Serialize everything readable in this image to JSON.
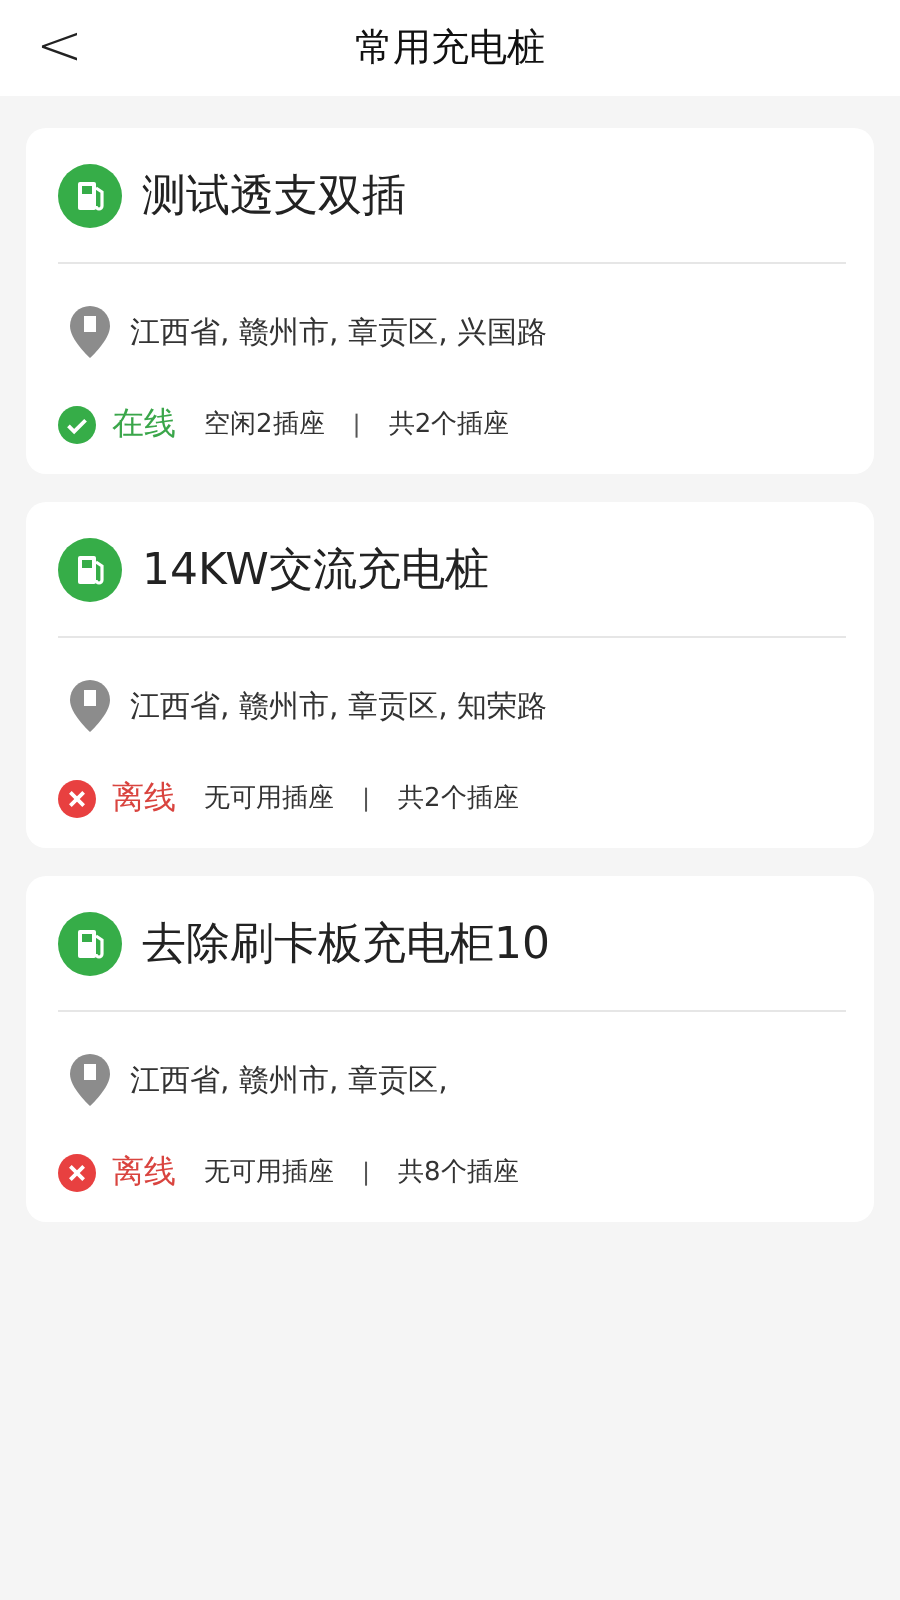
{
  "header": {
    "back": "<",
    "title": "常用充电桩"
  },
  "stations": [
    {
      "name": "测试透支双插",
      "address": "江西省, 赣州市, 章贡区, 兴国路",
      "online": true,
      "status": "在线",
      "free": "空闲2插座",
      "separator": "|",
      "total": "共2个插座"
    },
    {
      "name": "14KW交流充电桩",
      "address": "江西省, 赣州市, 章贡区, 知荣路",
      "online": false,
      "status": "离线",
      "free": "无可用插座",
      "separator": "|",
      "total": "共2个插座"
    },
    {
      "name": "去除刷卡板充电柜10",
      "address": "江西省, 赣州市, 章贡区,",
      "online": false,
      "status": "离线",
      "free": "无可用插座",
      "separator": "|",
      "total": "共8个插座"
    }
  ]
}
